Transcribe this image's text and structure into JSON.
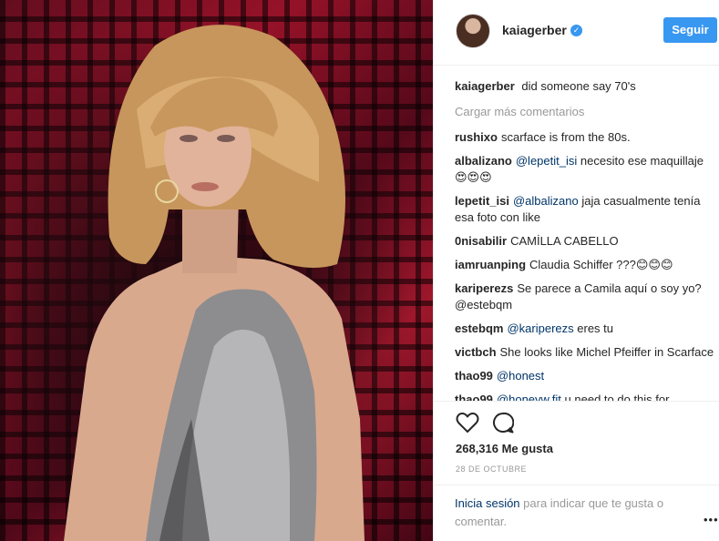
{
  "photo": {
    "alt_icon": "post-photo"
  },
  "header": {
    "username": "kaiagerber",
    "verified_icon": "verified-badge-icon",
    "follow_label": "Seguir"
  },
  "caption": {
    "user": "kaiagerber",
    "text": "did someone say 70's"
  },
  "load_more": "Cargar más comentarios",
  "comments": [
    {
      "user": "rushixo",
      "mention": "",
      "text": "scarface is from the 80s."
    },
    {
      "user": "albalizano",
      "mention": "@lepetit_isi",
      "text": "necesito ese maquillaje 😍😍😍"
    },
    {
      "user": "lepetit_isi",
      "mention": "@albalizano",
      "text": "jaja casualmente tenía esa foto con like"
    },
    {
      "user": "0nisabilir",
      "mention": "",
      "text": "CAMİLLA CABELLO"
    },
    {
      "user": "iamruanping",
      "mention": "",
      "text": "Claudia Schiffer ???😊😊😊"
    },
    {
      "user": "kariperezs",
      "mention": "",
      "text": "Se parece a Camila aquí o soy yo? @estebqm"
    },
    {
      "user": "estebqm",
      "mention": "@kariperezs",
      "text": "eres tu"
    },
    {
      "user": "victbch",
      "mention": "",
      "text": "She looks like Michel Pfeiffer in Scarface"
    },
    {
      "user": "thao99",
      "mention": "@honest",
      "text": ""
    },
    {
      "user": "thao99",
      "mention": "@honeyw.fit",
      "text": "u need to do this for"
    }
  ],
  "actions": {
    "like_icon": "heart-icon",
    "comment_icon": "comment-bubble-icon",
    "likes": "268,316 Me gusta",
    "date": "28 DE OCTUBRE"
  },
  "login": {
    "link": "Inicia sesión",
    "text": " para indicar que te gusta o comentar.",
    "more_icon": "more-options-icon",
    "more_glyph": "•••"
  },
  "colors": {
    "accent": "#3897f0",
    "mention": "#003569",
    "muted": "#999999"
  }
}
